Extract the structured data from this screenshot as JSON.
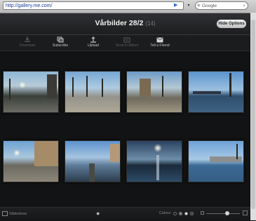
{
  "browser": {
    "url": "http://gallery.me.com/",
    "search_placeholder": "Google"
  },
  "album": {
    "title": "Vårbilder 28/2",
    "count": "(14)",
    "hide_options_label": "Hide Options"
  },
  "toolbar": [
    {
      "label": "Download",
      "icon": "download-icon",
      "enabled": false
    },
    {
      "label": "Subscribe",
      "icon": "subscribe-icon",
      "enabled": true
    },
    {
      "label": "Upload",
      "icon": "upload-icon",
      "enabled": true
    },
    {
      "label": "Send to Album",
      "icon": "send-to-album-icon",
      "enabled": false
    },
    {
      "label": "Tell a Friend",
      "icon": "envelope-icon",
      "enabled": true
    }
  ],
  "photos": [
    {
      "name": "photo-1"
    },
    {
      "name": "photo-2"
    },
    {
      "name": "photo-3"
    },
    {
      "name": "photo-4"
    },
    {
      "name": "photo-5"
    },
    {
      "name": "photo-6"
    },
    {
      "name": "photo-7"
    },
    {
      "name": "photo-8"
    }
  ],
  "footer": {
    "slideshow_label": "Slideshow",
    "colors_label": "Colors:",
    "zoom_level": 0.62
  },
  "colors": {
    "background": "#121314",
    "toolbar": "#1b1c1e",
    "link": "#1a3a9a"
  }
}
